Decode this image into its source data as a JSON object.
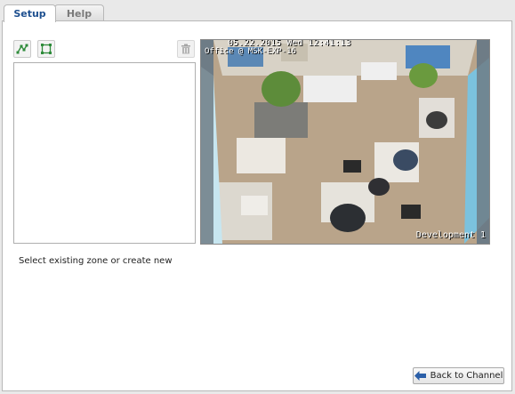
{
  "tabs": [
    {
      "label": "Setup",
      "active": true
    },
    {
      "label": "Help",
      "active": false
    }
  ],
  "toolbar": {
    "polyline_icon": "polyline-zone-icon",
    "rect_icon": "rectangle-zone-icon",
    "delete_icon": "trash-icon"
  },
  "video": {
    "overlay_top": "05.22.2015 Wed 12:41:13",
    "overlay_label": "Office @ MSK-EXP-16",
    "overlay_bottom": "Development 1"
  },
  "hint_text": "Select existing zone or create new",
  "back_button": {
    "label": "Back to Channel",
    "icon": "arrow-left-icon"
  },
  "colors": {
    "accent": "#1d4f8f",
    "icon_green": "#2e8b3a",
    "back_arrow": "#2b5fa8"
  }
}
